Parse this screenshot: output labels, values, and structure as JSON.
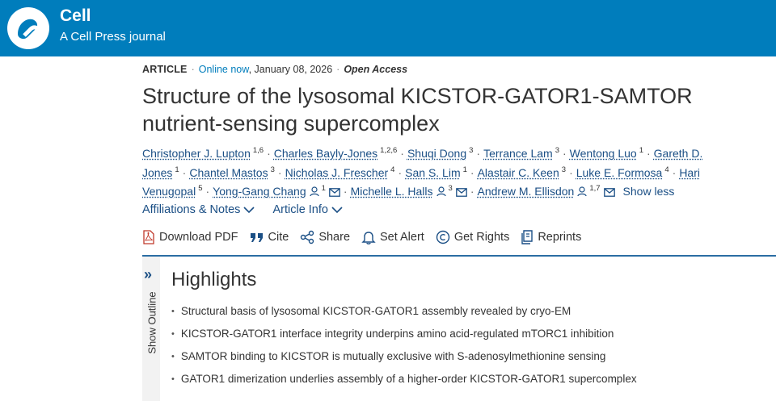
{
  "header": {
    "brand_name": "Cell",
    "brand_subtitle": "A Cell Press journal",
    "brand_color": "#007dbc"
  },
  "article_meta": {
    "type": "ARTICLE",
    "status": "Online now",
    "date": ", January 08, 2026",
    "access": "Open Access"
  },
  "title": "Structure of the lysosomal KICSTOR-GATOR1-SAMTOR nutrient-sensing supercomplex",
  "authors": [
    {
      "name": "Christopher J. Lupton",
      "aff": "1,6"
    },
    {
      "name": "Charles Bayly-Jones",
      "aff": "1,2,6"
    },
    {
      "name": "Shuqi Dong",
      "aff": "3"
    },
    {
      "name": "Terrance Lam",
      "aff": "3"
    },
    {
      "name": "Wentong Luo",
      "aff": "1"
    },
    {
      "name": "Gareth D. Jones",
      "aff": "1"
    },
    {
      "name": "Chantel Mastos",
      "aff": "3"
    },
    {
      "name": "Nicholas J. Frescher",
      "aff": "4"
    },
    {
      "name": "San S. Lim",
      "aff": "1"
    },
    {
      "name": "Alastair C. Keen",
      "aff": "3"
    },
    {
      "name": "Luke E. Formosa",
      "aff": "4"
    },
    {
      "name": "Hari Venugopal",
      "aff": "5"
    },
    {
      "name": "Yong-Gang Chang",
      "aff": "1"
    },
    {
      "name": "Michelle L. Halls",
      "aff": "3"
    },
    {
      "name": "Andrew M. Ellisdon",
      "aff": "1,7"
    }
  ],
  "show_less": "Show less",
  "info_links": {
    "affiliations": "Affiliations & Notes",
    "article_info": "Article Info"
  },
  "actions": {
    "download_pdf": "Download PDF",
    "cite": "Cite",
    "share": "Share",
    "set_alert": "Set Alert",
    "get_rights": "Get Rights",
    "reprints": "Reprints"
  },
  "outline": {
    "label": "Show Outline"
  },
  "highlights": {
    "title": "Highlights",
    "items": [
      "Structural basis of lysosomal KICSTOR-GATOR1 assembly revealed by cryo-EM",
      "KICSTOR-GATOR1 interface integrity underpins amino acid-regulated mTORC1 inhibition",
      "SAMTOR binding to KICSTOR is mutually exclusive with S-adenosylmethionine sensing",
      "GATOR1 dimerization underlies assembly of a higher-order KICSTOR-GATOR1 supercomplex"
    ]
  },
  "icons": {
    "logo": "cell-logo-icon",
    "person": "person-icon",
    "mail": "mail-icon",
    "chevron": "chevron-down-icon",
    "pdf": "pdf-icon",
    "cite": "quote-icon",
    "share": "share-icon",
    "alert": "bell-icon",
    "rights": "copyright-icon",
    "reprints": "reprints-icon"
  }
}
